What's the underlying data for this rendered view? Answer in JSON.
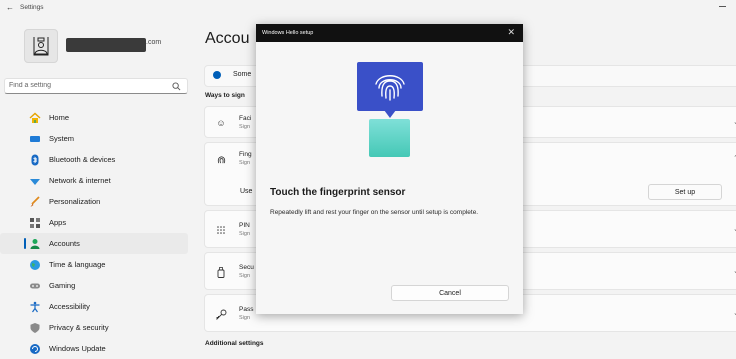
{
  "window": {
    "title": "Settings"
  },
  "user": {
    "email_suffix": ".com"
  },
  "search": {
    "placeholder": "Find a setting"
  },
  "nav": [
    {
      "label": "Home",
      "icon": "home-icon"
    },
    {
      "label": "System",
      "icon": "system-icon"
    },
    {
      "label": "Bluetooth & devices",
      "icon": "bluetooth-icon"
    },
    {
      "label": "Network & internet",
      "icon": "network-icon"
    },
    {
      "label": "Personalization",
      "icon": "brush-icon"
    },
    {
      "label": "Apps",
      "icon": "apps-icon"
    },
    {
      "label": "Accounts",
      "icon": "accounts-icon",
      "selected": true
    },
    {
      "label": "Time & language",
      "icon": "globe-icon"
    },
    {
      "label": "Gaming",
      "icon": "gaming-icon"
    },
    {
      "label": "Accessibility",
      "icon": "accessibility-icon"
    },
    {
      "label": "Privacy & security",
      "icon": "shield-icon"
    },
    {
      "label": "Windows Update",
      "icon": "update-icon"
    }
  ],
  "main": {
    "title": "Accou",
    "info_text": "Some",
    "section_heading": "Ways to sign",
    "cards": {
      "face": {
        "title": "Faci",
        "sub": "Sign"
      },
      "fingerprint": {
        "title": "Fing",
        "sub": "Sign"
      },
      "use_label": "Use",
      "setup_button": "Set up",
      "pin": {
        "title": "PIN",
        "sub": "Sign"
      },
      "security_key": {
        "title": "Secu",
        "sub": "Sign"
      },
      "password": {
        "title": "Pass",
        "sub": "Sign"
      }
    },
    "additional_settings": "Additional settings"
  },
  "dialog": {
    "title": "Windows Hello setup",
    "heading": "Touch the fingerprint sensor",
    "body": "Repeatedly lift and rest your finger on the sensor until setup is complete.",
    "cancel_label": "Cancel"
  },
  "colors": {
    "accent": "#005fb8",
    "fingerprint_card": "#3a50c8",
    "sensor": "#45c8b6",
    "dialog_header": "#111111"
  }
}
